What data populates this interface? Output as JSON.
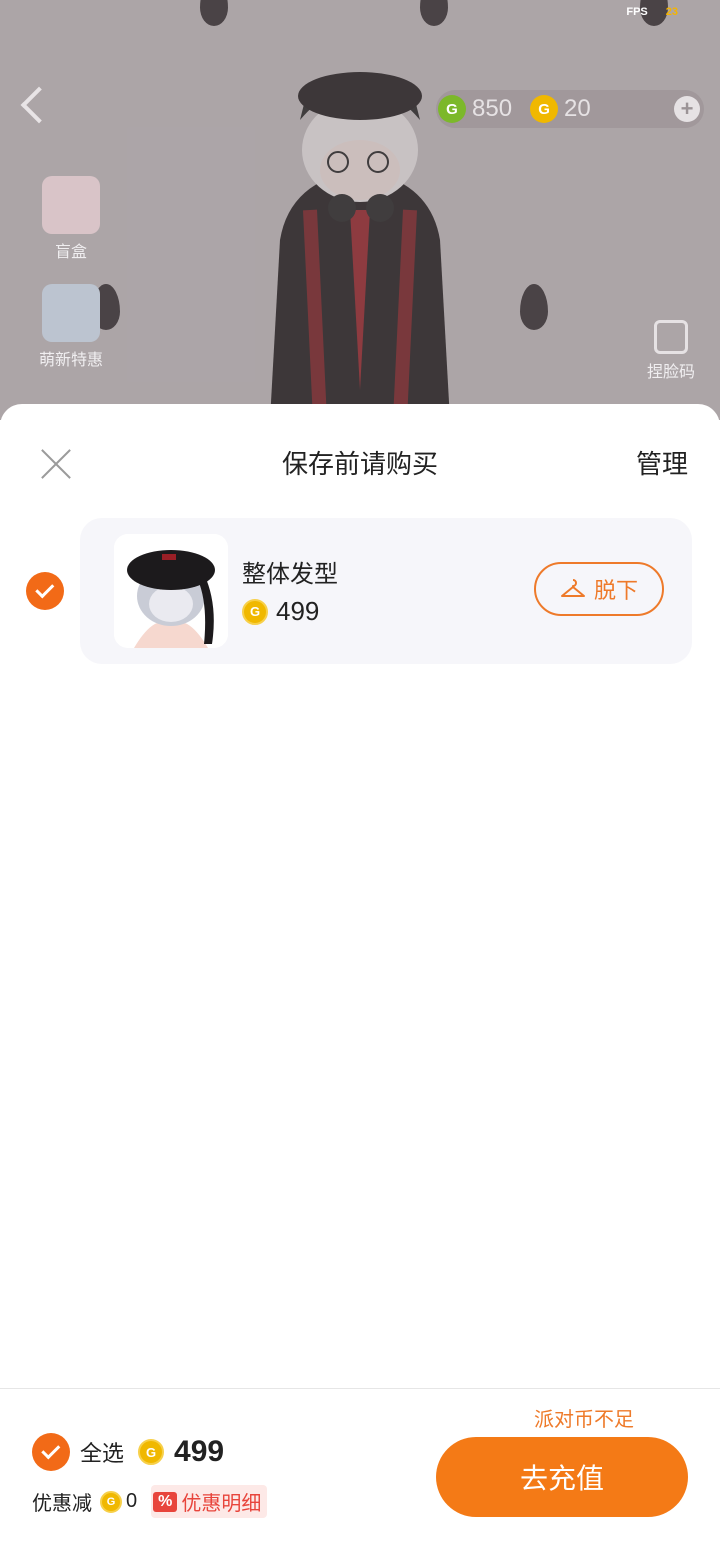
{
  "game": {
    "fps_label": "FPS",
    "fps_value": "23",
    "currency_green": "850",
    "currency_gold": "20",
    "side_items": [
      "盲盒",
      "萌新特惠"
    ],
    "right_item": "捏脸码"
  },
  "sheet": {
    "title": "保存前请购买",
    "manage_label": "管理"
  },
  "items": [
    {
      "name": "整体发型",
      "price": "499",
      "remove_label": "脱下",
      "checked": true
    }
  ],
  "footer": {
    "insufficient": "派对币不足",
    "select_all_label": "全选",
    "total": "499",
    "discount_label": "优惠减",
    "discount_value": "0",
    "discount_detail_label": "优惠明细",
    "discount_badge": "%",
    "recharge_label": "去充值"
  },
  "colors": {
    "accent": "#f47a16",
    "coin": "#f0b800",
    "sheet_bg": "#ffffff"
  }
}
